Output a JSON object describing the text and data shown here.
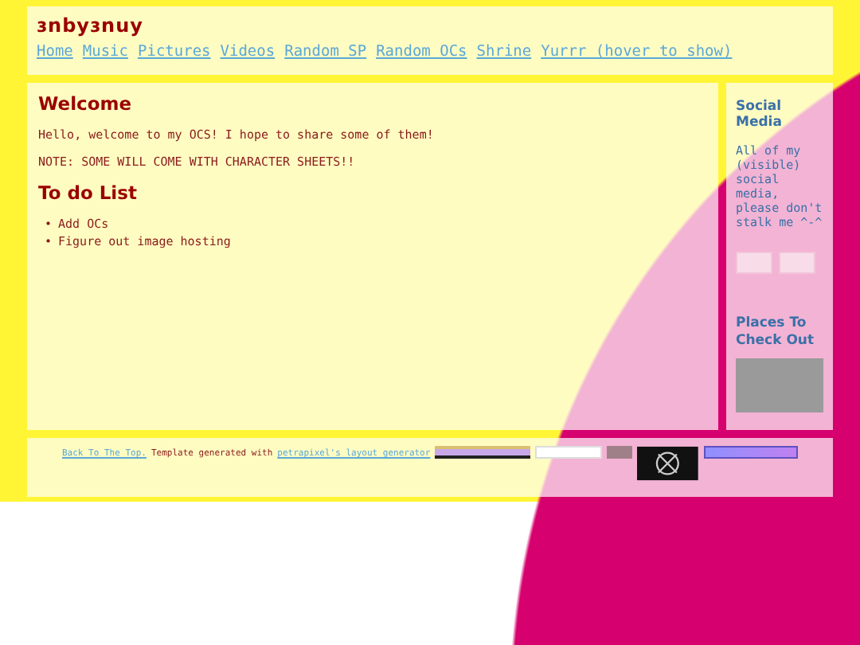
{
  "header": {
    "title": "ɜnbyɜnuy",
    "nav": [
      {
        "label": "Home"
      },
      {
        "label": "Music"
      },
      {
        "label": "Pictures"
      },
      {
        "label": "Videos"
      },
      {
        "label": "Random SP"
      },
      {
        "label": "Random OCs"
      },
      {
        "label": "Shrine"
      },
      {
        "label": "Yurrr (hover to show)"
      }
    ]
  },
  "main": {
    "heading": "Welcome",
    "paragraphs": [
      "Hello, welcome to my OCS! I hope to share some of them!",
      "NOTE: SOME WILL COME WITH CHARACTER SHEETS!!"
    ],
    "todo_heading": "To do List",
    "todo_items": [
      {
        "marker": "•",
        "text": "Add OCs"
      },
      {
        "marker": "•",
        "text": "Figure out image hosting"
      }
    ]
  },
  "sidebar": {
    "social_heading": "Social Media",
    "social_text": "All of my (visible) social media, please don't stalk me ^-^",
    "places_heading": "Places To Check Out"
  },
  "footer": {
    "back_link": "Back To The Top.",
    "text": "Template generated with",
    "generator_link": "petrapixel's layout generator"
  }
}
